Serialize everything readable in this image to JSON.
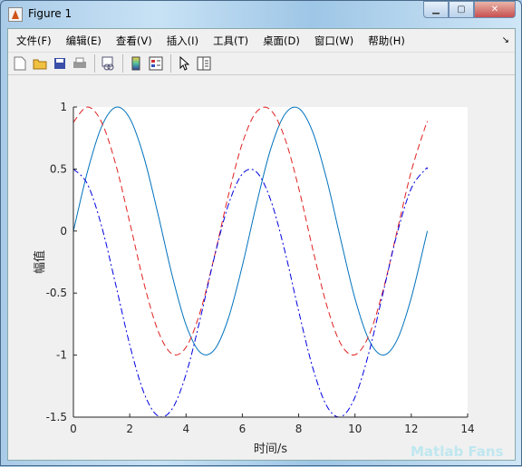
{
  "window": {
    "title": "Figure 1",
    "controls": [
      "minimize",
      "maximize",
      "close"
    ]
  },
  "menubar": {
    "items": [
      "文件(F)",
      "编辑(E)",
      "查看(V)",
      "插入(I)",
      "工具(T)",
      "桌面(D)",
      "窗口(W)",
      "帮助(H)"
    ]
  },
  "toolbar": {
    "icons": [
      "new-figure-icon",
      "open-file-icon",
      "save-icon",
      "print-icon",
      "link-plot-icon",
      "colorbar-icon",
      "legend-icon",
      "edit-plot-arrow-icon",
      "property-inspector-icon"
    ]
  },
  "watermark": "Matlab Fans",
  "chart_data": {
    "type": "line",
    "xlabel": "时间/s",
    "ylabel": "幅值",
    "title": "",
    "xlim": [
      0,
      14
    ],
    "ylim": [
      -1.5,
      1
    ],
    "xticks": [
      "0",
      "2",
      "4",
      "6",
      "8",
      "10",
      "12",
      "14"
    ],
    "yticks": [
      "1",
      "0.5",
      "0",
      "-0.5",
      "-1",
      "-1.5"
    ],
    "grid": false,
    "x": [
      0,
      0.5,
      1,
      1.5,
      2,
      2.5,
      3,
      3.5,
      4,
      4.5,
      5,
      5.5,
      6,
      6.5,
      7,
      7.5,
      8,
      8.5,
      9,
      9.5,
      10,
      10.5,
      11,
      11.5,
      12,
      12.5,
      12.566
    ],
    "series": [
      {
        "style": "solid",
        "color": "#0072BD",
        "values": [
          0,
          0.4794,
          0.8415,
          0.9975,
          0.9093,
          0.5985,
          0.1411,
          -0.3508,
          -0.7568,
          -0.9775,
          -0.9589,
          -0.7055,
          -0.2794,
          0.2151,
          0.657,
          0.938,
          0.9894,
          0.7985,
          0.4121,
          -0.0752,
          -0.544,
          -0.8797,
          -1,
          -0.8755,
          -0.5366,
          -0.0663,
          0
        ]
      },
      {
        "style": "dashed",
        "color": "#e02020",
        "values": [
          0.8776,
          1,
          0.8776,
          0.5403,
          0.0707,
          -0.4161,
          -0.8011,
          -0.99,
          -0.9365,
          -0.6536,
          -0.2108,
          0.2837,
          0.7087,
          0.9602,
          0.9766,
          0.7539,
          0.3466,
          -0.1455,
          -0.602,
          -0.9111,
          -0.9972,
          -0.8391,
          -0.4755,
          0.0044,
          0.4833,
          0.8439,
          0.8776
        ]
      },
      {
        "style": "dashdot",
        "color": "#0000e0",
        "values": [
          0.5,
          0.3776,
          0.0403,
          -0.4293,
          -0.9161,
          -1.3011,
          -1.49,
          -1.4365,
          -1.1536,
          -0.7108,
          -0.2163,
          0.2087,
          0.4602,
          0.4766,
          0.2539,
          -0.1534,
          -0.6455,
          -1.102,
          -1.4111,
          -1.4972,
          -1.3391,
          -0.9755,
          -0.4956,
          -0.0167,
          0.3439,
          0.4978,
          0.5
        ]
      }
    ]
  }
}
